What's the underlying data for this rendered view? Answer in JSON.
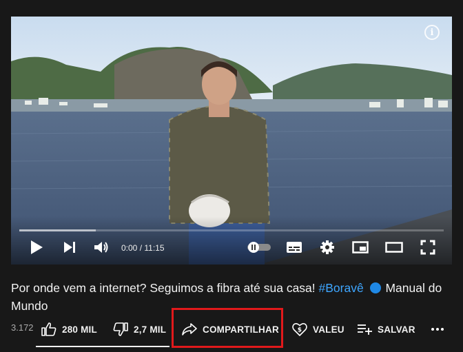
{
  "player": {
    "info_icon": "i",
    "time_display": "0:00 / 11:15",
    "progress_played": 0.0,
    "progress_buffered": 0.18,
    "icons": [
      "play-icon",
      "next-icon",
      "volume-icon",
      "autoplay-toggle-icon",
      "subtitles-icon",
      "settings-icon",
      "miniplayer-icon",
      "theater-icon",
      "fullscreen-icon"
    ]
  },
  "video": {
    "title_main": "Por onde vem a internet? Seguimos a fibra até sua casa! ",
    "title_hashtag": "#Boravê",
    "title_channel": "Manual do Mundo",
    "views": "3.172"
  },
  "actions": {
    "like_count": "280 MIL",
    "dislike_count": "2,7 MIL",
    "share_label": "COMPARTILHAR",
    "thanks_label": "VALEU",
    "save_label": "SALVAR",
    "more_label": "..."
  },
  "colors": {
    "background": "#181818",
    "hashtag": "#3ea6ff",
    "highlight": "#e1191b"
  }
}
